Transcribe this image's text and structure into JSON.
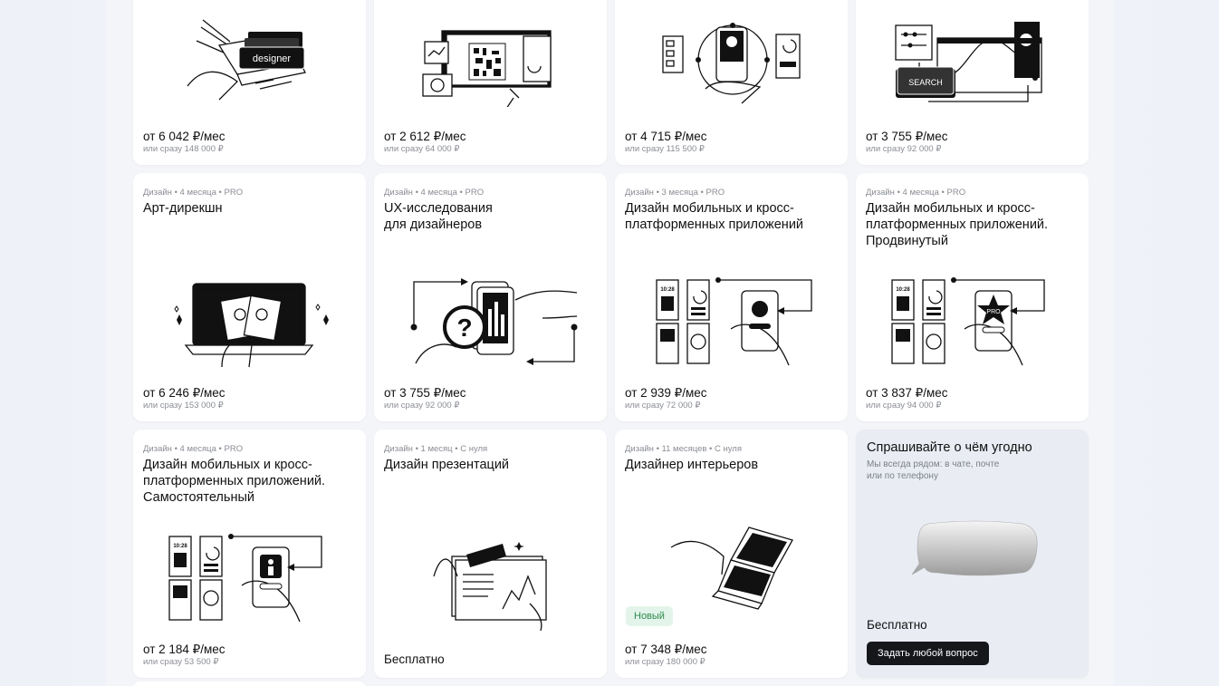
{
  "row1": [
    {
      "price": "от 6 042 ₽/мес",
      "sub": "или сразу 148 000 ₽",
      "illustration": "designer-laptop-icon",
      "illustration_text": "designer"
    },
    {
      "price": "от 2 612 ₽/мес",
      "sub": "или сразу 64 000 ₽",
      "illustration": "qr-editor-icon"
    },
    {
      "price": "от 4 715 ₽/мес",
      "sub": "или сразу 115 500 ₽",
      "illustration": "phone-prototype-icon"
    },
    {
      "price": "от 3 755 ₽/мес",
      "sub": "или сразу 92 000 ₽",
      "illustration": "search-flow-icon",
      "illustration_text": "SEARCH"
    }
  ],
  "row2": [
    {
      "meta": "Дизайн • 4 месяца • PRO",
      "title": "Арт-дирекшн",
      "price": "от 6 246 ₽/мес",
      "sub": "или сразу 153 000 ₽",
      "illustration": "art-direction-icon"
    },
    {
      "meta": "Дизайн • 4 месяца • PRO",
      "title": "UX-исследования\nдля дизайнеров",
      "price": "от 3 755 ₽/мес",
      "sub": "или сразу 92 000 ₽",
      "illustration": "ux-research-icon"
    },
    {
      "meta": "Дизайн • 3 месяца • PRO",
      "title": "Дизайн мобильных и кросс-платформенных приложений",
      "price": "от 2 939 ₽/мес",
      "sub": "или сразу 72 000 ₽",
      "illustration": "mobile-apps-icon",
      "illustration_text": "10:28"
    },
    {
      "meta": "Дизайн • 4 месяца • PRO",
      "title": "Дизайн мобильных и кросс-платформенных приложений. Продвинутый",
      "price": "от 3 837 ₽/мес",
      "sub": "или сразу 94 000 ₽",
      "illustration": "mobile-apps-pro-icon",
      "illustration_text": "10:28",
      "illustration_badge": "PRO"
    }
  ],
  "row3": [
    {
      "meta": "Дизайн • 4 месяца • PRO",
      "title": "Дизайн мобильных и кросс-платформенных приложений. Самостоятельный",
      "price": "от 2 184 ₽/мес",
      "sub": "или сразу 53 500 ₽",
      "illustration": "mobile-apps-self-icon",
      "illustration_text": "10:28"
    },
    {
      "meta": "Дизайн • 1 месяц • С нуля",
      "title": "Дизайн презентаций",
      "price": "Бесплатно",
      "illustration": "presentation-icon"
    },
    {
      "meta": "Дизайн • 11 месяцев • С нуля",
      "title": "Дизайнер интерьеров",
      "badge": "Новый",
      "price": "от 7 348 ₽/мес",
      "sub": "или сразу 180 000 ₽",
      "illustration": "interior-laptop-icon"
    }
  ],
  "ask": {
    "title": "Спрашивайте о чём угодно",
    "subtitle": "Мы всегда рядом: в чате, почте или по телефону",
    "free": "Бесплатно",
    "button": "Задать любой вопрос",
    "illustration": "chat-bubble-icon"
  }
}
